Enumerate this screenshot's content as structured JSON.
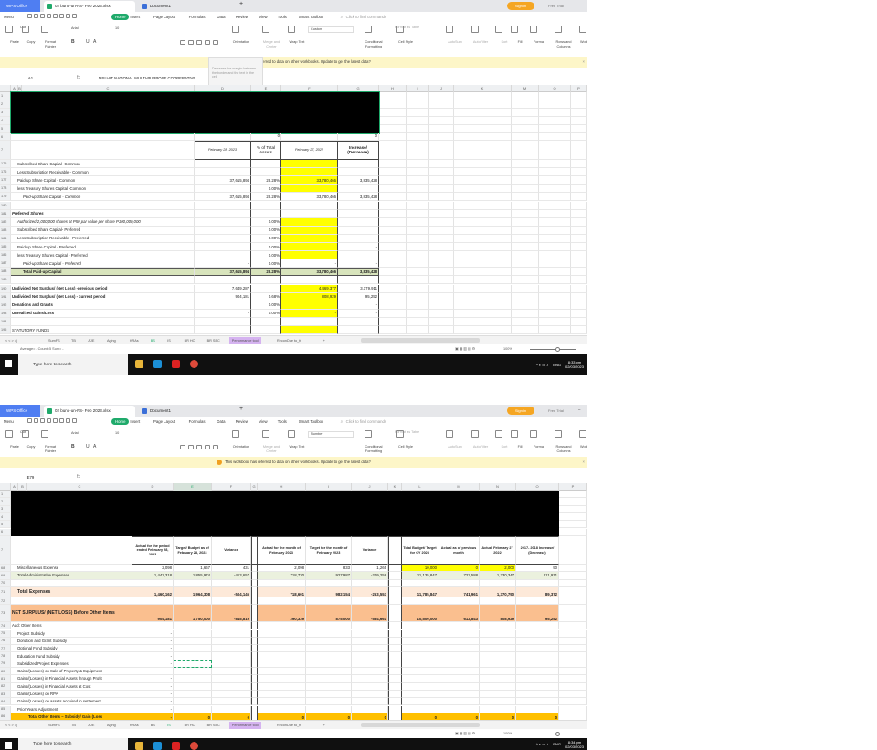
{
  "common": {
    "app_tab": "WPS Office",
    "file_tab": "02 bunu-un-FS- Feb 2023.xlsx",
    "doc_tab": "Document1",
    "sign_in": "Sign in",
    "free_trial": "Free Trial",
    "menu": [
      "Menu",
      "Home",
      "Insert",
      "Page Layout",
      "Formulas",
      "Data",
      "Review",
      "View",
      "Tools",
      "Smart Toolbox"
    ],
    "search_commands": "Click to find commands",
    "ribbon": {
      "paste": "Paste",
      "cut": "Cut",
      "copy": "Copy",
      "format_painter": "Format Painter",
      "font": "Arial",
      "font_size": "10",
      "orientation": "Orientation",
      "merge_center": "Merge and Center",
      "wrap_text": "Wrap Text",
      "conditional_formatting": "Conditional Formatting",
      "format_as_table": "Format as Table",
      "cell_style": "Cell Style",
      "autosum": "AutoSum",
      "autofilter": "AutoFilter",
      "sort": "Sort",
      "fill": "Fill",
      "format": "Format",
      "rows_columns": "Rows and Columns",
      "worksheet": "Worksheet"
    },
    "notification": "This workbook has referred to data on other workbooks. Update to get the latest data?",
    "sheet_tabs": [
      "SumFS",
      "TB",
      "AJE",
      "Aging",
      "KRAs",
      "BS",
      "IS",
      "BR HO",
      "BR SBC",
      "Performance tool",
      "ReconDue to_fr"
    ],
    "zoom": "100%",
    "taskbar_search": "Type here to search",
    "lang": "ENG",
    "date": "02/03/2023",
    "colors": {
      "yellow": "#ffff00",
      "green_total": "#d8e4bc",
      "light_green": "#ebf1de",
      "peach": "#fde9d9",
      "orange": "#fabf8f",
      "gold": "#ffc000",
      "accent": "#1faa6b"
    }
  },
  "windows": [
    {
      "number_format": "Custom",
      "name_box": "A1",
      "formula": "MSU-IIT NATIONAL MULTI-PURPOSE COOPERATIVE",
      "tooltip": "Decrease the margin between the border and the text in the cell",
      "active_sheet": "BS",
      "status": "Average= -  Count=5  Sum= -",
      "time": "8:33 pm",
      "col_headers": [
        "A",
        "B",
        "C",
        "D",
        "E",
        "F",
        "G",
        "H",
        "I",
        "J",
        "K",
        "M",
        "O",
        "P"
      ],
      "row6": {
        "n": "6",
        "d": "0",
        "f": "0"
      },
      "header": {
        "n": "7",
        "d": "February 28, 2023",
        "e": "% of Total Assets",
        "f": "February 27, 2022",
        "g": "Increase/ (Decrease)"
      },
      "rows": [
        {
          "n": "175",
          "label": "Subscribed Share Capital- Common",
          "indent": 1,
          "v": [
            "",
            "",
            "",
            ""
          ],
          "hl": true
        },
        {
          "n": "176",
          "label": "Less Subscription Receivable - Common",
          "indent": 1,
          "v": [
            "",
            "",
            "",
            ""
          ],
          "hl": true
        },
        {
          "n": "177",
          "label": "Paid-up Share Capital - Common",
          "indent": 1,
          "v": [
            "37,615,894",
            "28.28%",
            "33,780,466",
            "3,835,428"
          ],
          "hl": true
        },
        {
          "n": "178",
          "label": "less Treasury Shares Capital -Common",
          "indent": 1,
          "v": [
            "",
            "0.00%",
            "",
            ""
          ],
          "hl": true
        },
        {
          "n": "179",
          "label": "Paid-up Share Capital - Common",
          "indent": 2,
          "italic": true,
          "v": [
            "37,615,894",
            "28.28%",
            "33,780,466",
            "3,835,428"
          ]
        },
        {
          "n": "180",
          "label": "",
          "v": [
            "",
            "",
            "",
            ""
          ]
        },
        {
          "n": "181",
          "label": "Preferred Shares",
          "bold": true,
          "italic": true,
          "v": [
            "",
            "",
            "",
            ""
          ]
        },
        {
          "n": "182",
          "label": "Authorized 2,000,000 shares at P50 par value per share P100,000,000",
          "indent": 1,
          "italic": true,
          "v": [
            "",
            "0.00%",
            "",
            ""
          ],
          "hl": true
        },
        {
          "n": "183",
          "label": "Subscribed Share Capital- Preferred",
          "indent": 1,
          "v": [
            "",
            "0.00%",
            "",
            ""
          ],
          "hl": true
        },
        {
          "n": "184",
          "label": "Less Subscription Receivable - Preferred",
          "indent": 1,
          "v": [
            "",
            "0.00%",
            "",
            ""
          ],
          "hl": true
        },
        {
          "n": "185",
          "label": "Paid-up Share Capital - Preferred",
          "indent": 1,
          "v": [
            "",
            "0.00%",
            "",
            "-"
          ],
          "hl": true
        },
        {
          "n": "186",
          "label": "less Treasury Shares Capital - Preferred",
          "indent": 1,
          "v": [
            "",
            "0.00%",
            "",
            ""
          ],
          "hl": true
        },
        {
          "n": "187",
          "label": "Paid-up Share Capital - Preferred",
          "indent": 2,
          "italic": true,
          "v": [
            "-",
            "0.00%",
            "-",
            "-"
          ]
        },
        {
          "n": "188",
          "label": "Total Paid-up Capital",
          "indent": 2,
          "bold": true,
          "total": true,
          "v": [
            "37,615,894",
            "28.28%",
            "33,780,466",
            "3,835,428"
          ]
        },
        {
          "n": "189",
          "label": "",
          "v": [
            "",
            "",
            "",
            ""
          ]
        },
        {
          "n": "190",
          "label": "Undivided Net Surplus/ (Net Loss) -previous period",
          "bold": true,
          "v": [
            "7,649,287",
            "",
            "4,469,377",
            "3,179,911"
          ],
          "hl": true
        },
        {
          "n": "191",
          "label": "Undivided Net Surplus/ (Net Loss) - current period",
          "bold": true,
          "v": [
            "904,181",
            "0.68%",
            "808,929",
            "95,252"
          ],
          "hl": true
        },
        {
          "n": "192",
          "label": "Donations and Grants",
          "bold": true,
          "v": [
            "",
            "0.00%",
            "",
            "-"
          ],
          "hl": true
        },
        {
          "n": "193",
          "label": "Unrealized Gains/Loss",
          "bold": true,
          "v": [
            "-",
            "0.00%",
            "-",
            "-"
          ],
          "hl": true
        },
        {
          "n": "194",
          "label": "",
          "v": [
            "",
            "",
            "",
            ""
          ]
        },
        {
          "n": "195",
          "label": "STATUTORY FUNDS",
          "v": [
            "",
            "",
            "",
            ""
          ],
          "hl": true
        }
      ]
    },
    {
      "number_format": "Number",
      "name_box": "E79",
      "formula": "",
      "active_sheet": "IS",
      "status": "",
      "time": "8:34 pm",
      "col_headers": [
        "A",
        "B",
        "C",
        "D",
        "E",
        "F",
        "G",
        "H",
        "I",
        "J",
        "K",
        "L",
        "M",
        "N",
        "O",
        "P"
      ],
      "header": {
        "n": "7",
        "cols": [
          "Actual for the period ended February 28, 2023",
          "Target/ Budget as of February 28, 2023",
          "Variance",
          "",
          "Actual for the month of February 2023",
          "Target for the month of February 2023",
          "Variance",
          "",
          "Total Budget/ Target for CY 2023",
          "Actual as of previous month",
          "Actual February 27 2022",
          "2017- 2018 Increase/ (Decrease)"
        ]
      },
      "rows": [
        {
          "n": "68",
          "label": "Miscellaneous Expense",
          "indent": 1,
          "v": [
            "2,098",
            "1,667",
            "431",
            "",
            "2,098",
            "833",
            "1,265",
            "",
            "10,000",
            "0",
            "2,000",
            "90"
          ],
          "hl": true
        },
        {
          "n": "69",
          "label": "Total Administrative Expenses",
          "indent": 1,
          "style": "light_green",
          "v": [
            "1,442,318",
            "1,855,974",
            "-413,657",
            "",
            "718,730",
            "927,987",
            "-209,258",
            "",
            "11,135,847",
            "723,588",
            "1,330,347",
            "111,971"
          ]
        },
        {
          "n": "70",
          "label": "",
          "v": []
        },
        {
          "n": "71",
          "label": "Total Expenses",
          "indent": 1,
          "bold": true,
          "style": "peach",
          "tall": 1,
          "v": [
            "1,460,162",
            "1,964,308",
            "-504,146",
            "",
            "718,601",
            "982,154",
            "-263,553",
            "",
            "11,785,847",
            "741,961",
            "1,370,790",
            "89,372"
          ]
        },
        {
          "n": "72",
          "label": "",
          "v": []
        },
        {
          "n": "73",
          "label": "NET SURPLUS/ (NET LOSS) Before Other Items",
          "bold": true,
          "style": "orange",
          "tall": 2,
          "v": [
            "904,181",
            "1,750,000",
            "-845,819",
            "",
            "290,339",
            "875,000",
            "-584,661",
            "",
            "10,500,000",
            "613,843",
            "808,929",
            "95,252"
          ]
        },
        {
          "n": "74",
          "label": "Add: Other Items",
          "v": []
        },
        {
          "n": "75",
          "label": "Project Subsidy",
          "indent": 1,
          "v": [
            "-"
          ]
        },
        {
          "n": "76",
          "label": "Donation and Grant Subsidy",
          "indent": 1,
          "v": [
            "-"
          ]
        },
        {
          "n": "77",
          "label": "Optional Fund Subsidy",
          "indent": 1,
          "v": [
            "-"
          ]
        },
        {
          "n": "78",
          "label": "Education Fund Subsidy",
          "indent": 1,
          "v": [
            "-"
          ]
        },
        {
          "n": "79",
          "label": "Subsidized Project Expenses",
          "indent": 1,
          "v": [
            "-"
          ],
          "selected": true
        },
        {
          "n": "80",
          "label": "Gains/(Losses) on Sale of Property & Equipment",
          "indent": 1,
          "v": [
            "-"
          ]
        },
        {
          "n": "81",
          "label": "Gains/(Losses) in Financial Assets through Profit",
          "indent": 1,
          "v": [
            "-"
          ]
        },
        {
          "n": "82",
          "label": "Gains/(Losses) in Financial Assets at Cost",
          "indent": 1,
          "v": [
            "-"
          ]
        },
        {
          "n": "83",
          "label": "Gains/(Losses) on RPA",
          "indent": 1,
          "v": [
            "-"
          ]
        },
        {
          "n": "84",
          "label": "Gains/(Losses) on assets acquired in settlement",
          "indent": 1,
          "v": [
            "-"
          ]
        },
        {
          "n": "85",
          "label": "Prior Years' Adjustment",
          "indent": 1,
          "v": [
            "-"
          ]
        },
        {
          "n": "86",
          "label": "Total Other Items – Subsidy/ Gain (Loss",
          "indent": 3,
          "bold": true,
          "style": "gold",
          "v": [
            "-",
            "0",
            "0",
            "",
            "0",
            "0",
            "0",
            "",
            "0",
            "0",
            "0",
            "0"
          ]
        }
      ]
    }
  ]
}
